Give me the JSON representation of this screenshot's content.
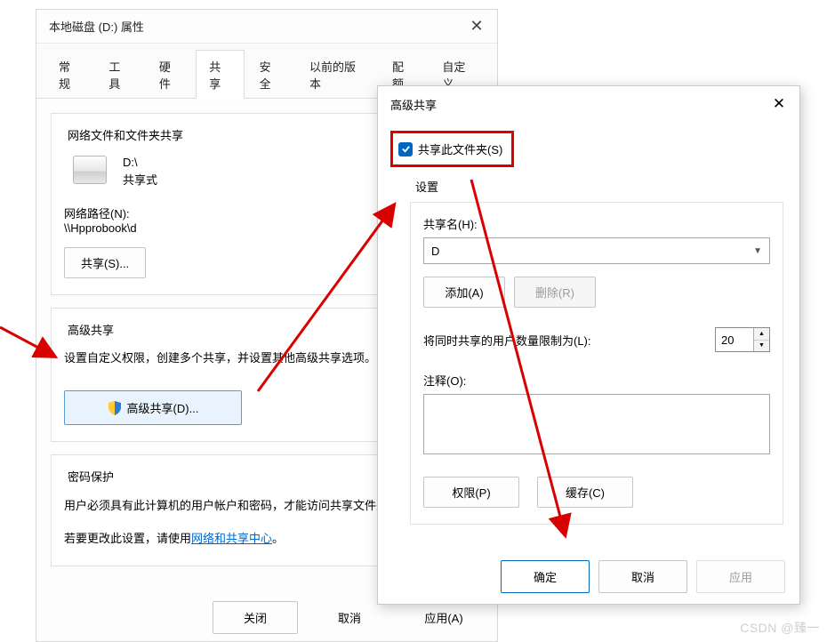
{
  "main": {
    "title": "本地磁盘 (D:) 属性",
    "tabs": {
      "general": "常规",
      "tools": "工具",
      "hardware": "硬件",
      "sharing": "共享",
      "security": "安全",
      "previous": "以前的版本",
      "quota": "配额",
      "custom": "自定义"
    },
    "net_share": {
      "group_title": "网络文件和文件夹共享",
      "drive_path": "D:\\",
      "share_state": "共享式",
      "net_path_label": "网络路径(N):",
      "net_path_value": "\\\\Hpprobook\\d",
      "share_btn": "共享(S)..."
    },
    "adv_share": {
      "group_title": "高级共享",
      "desc": "设置自定义权限，创建多个共享，并设置其他高级共享选项。",
      "btn": "高级共享(D)..."
    },
    "password": {
      "group_title": "密码保护",
      "text1": "用户必须具有此计算机的用户帐户和密码，才能访问共享文件夹。",
      "text2_prefix": "若要更改此设置，请使用",
      "link": "网络和共享中心",
      "text2_suffix": "。"
    },
    "bottom": {
      "close": "关闭",
      "cancel": "取消",
      "apply": "应用(A)"
    }
  },
  "advDialog": {
    "title": "高级共享",
    "share_checkbox": "共享此文件夹(S)",
    "settings_label": "设置",
    "share_name_label": "共享名(H):",
    "share_name_value": "D",
    "add_btn": "添加(A)",
    "remove_btn": "删除(R)",
    "limit_label": "将同时共享的用户数量限制为(L):",
    "limit_value": "20",
    "comment_label": "注释(O):",
    "perm_btn": "权限(P)",
    "cache_btn": "缓存(C)",
    "ok": "确定",
    "cancel": "取消",
    "apply": "应用"
  },
  "watermark": "CSDN @臻一"
}
